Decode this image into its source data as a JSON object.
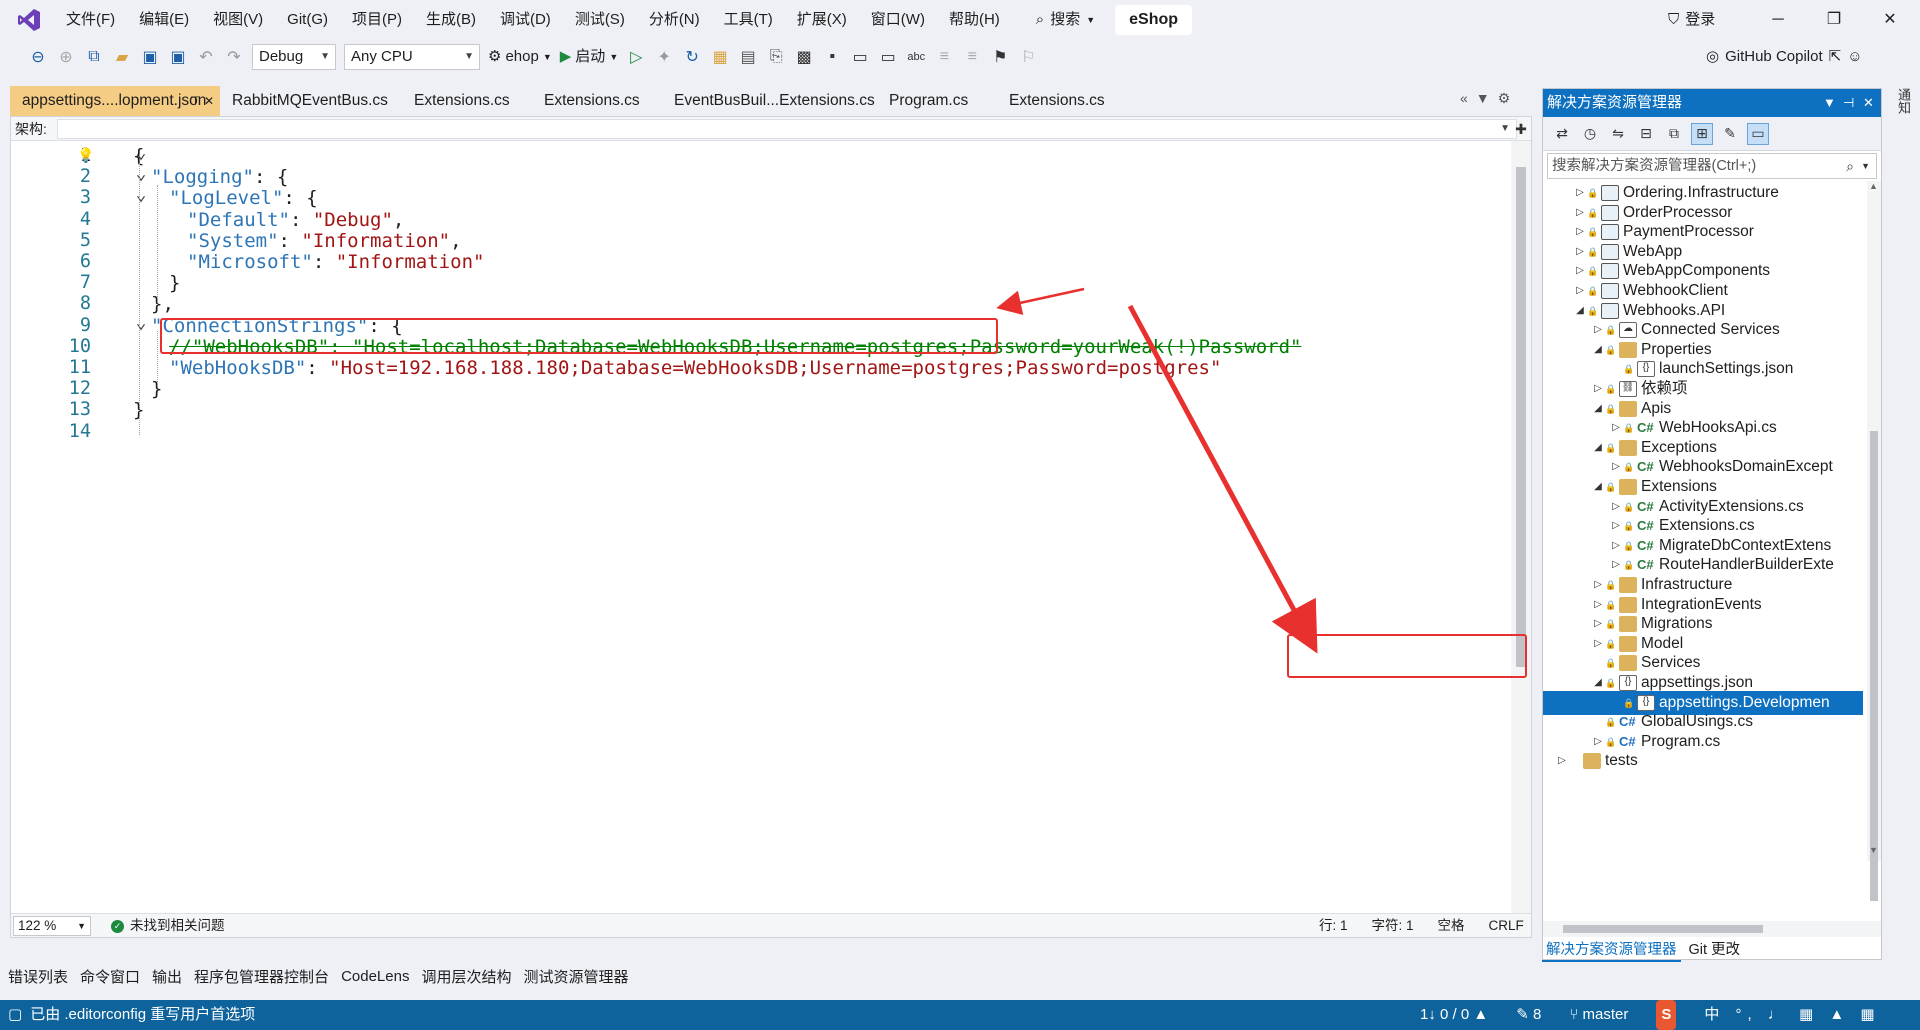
{
  "menu": [
    "文件(F)",
    "编辑(E)",
    "视图(V)",
    "Git(G)",
    "项目(P)",
    "生成(B)",
    "调试(D)",
    "测试(S)",
    "分析(N)",
    "工具(T)",
    "扩展(X)",
    "窗口(W)",
    "帮助(H)"
  ],
  "titlebar": {
    "search_label": "搜索",
    "solution_name": "eShop",
    "login_label": "登录"
  },
  "toolbar": {
    "config": "Debug",
    "platform": "Any CPU",
    "startup_project": "ehop",
    "start_label": "启动",
    "copilot_label": "GitHub Copilot"
  },
  "tabs": [
    "appsettings....lopment.json",
    "RabbitMQEventBus.cs",
    "Extensions.cs",
    "Extensions.cs",
    "EventBusBuil...Extensions.cs",
    "Program.cs",
    "Extensions.cs"
  ],
  "editor": {
    "nav_label": "架构:",
    "lines": [
      {
        "n": "1",
        "t": "{"
      },
      {
        "n": "2",
        "k": "\"Logging\"",
        "t": ": {"
      },
      {
        "n": "3",
        "k": "\"LogLevel\"",
        "t": ": {"
      },
      {
        "n": "4",
        "k": "\"Default\"",
        "t": ": ",
        "v": "\"Debug\"",
        "e": ","
      },
      {
        "n": "5",
        "k": "\"System\"",
        "t": ": ",
        "v": "\"Information\"",
        "e": ","
      },
      {
        "n": "6",
        "k": "\"Microsoft\"",
        "t": ": ",
        "v": "\"Information\"",
        "e": ""
      },
      {
        "n": "7",
        "t": "}"
      },
      {
        "n": "8",
        "t": "},"
      },
      {
        "n": "9",
        "k": "\"ConnectionStrings\"",
        "t": ": {"
      },
      {
        "n": "10",
        "c": "//\"WebHooksDB\": \"Host=localhost;Database=WebHooksDB;Username=postgres;Password=yourWeak(!)Password\""
      },
      {
        "n": "11",
        "k": "\"WebHooksDB\"",
        "t": ": ",
        "v": "\"Host=192.168.188.180;Database=WebHooksDB;Username=postgres;Password=postgres\"",
        "e": ""
      },
      {
        "n": "12",
        "t": "}"
      },
      {
        "n": "13",
        "t": "}"
      },
      {
        "n": "14",
        "t": ""
      }
    ],
    "zoom": "122 %",
    "issues": "未找到相关问题",
    "line_info": "行: 1",
    "char_info": "字符: 1",
    "whitespace": "空格",
    "eol": "CRLF"
  },
  "bottom_tabs": [
    "错误列表",
    "命令窗口",
    "输出",
    "程序包管理器控制台",
    "CodeLens",
    "调用层次结构",
    "测试资源管理器"
  ],
  "statusbar": {
    "message": "已由 .editorconfig 重写用户首选项",
    "sync": "1↓ 0 / 0 ▲",
    "edits": "8",
    "branch": "master"
  },
  "solution_explorer": {
    "title": "解决方案资源管理器",
    "search_placeholder": "搜索解决方案资源管理器(Ctrl+;)",
    "items": [
      {
        "label": "Ordering.Infrastructure",
        "type": "proj",
        "lvl": 1,
        "exp": "▷"
      },
      {
        "label": "OrderProcessor",
        "type": "proj",
        "lvl": 1,
        "exp": "▷"
      },
      {
        "label": "PaymentProcessor",
        "type": "proj",
        "lvl": 1,
        "exp": "▷"
      },
      {
        "label": "WebApp",
        "type": "proj",
        "lvl": 1,
        "exp": "▷"
      },
      {
        "label": "WebAppComponents",
        "type": "proj",
        "lvl": 1,
        "exp": "▷"
      },
      {
        "label": "WebhookClient",
        "type": "proj",
        "lvl": 1,
        "exp": "▷"
      },
      {
        "label": "Webhooks.API",
        "type": "proj",
        "lvl": 1,
        "exp": "◢"
      },
      {
        "label": "Connected Services",
        "type": "svc",
        "lvl": 2,
        "exp": "▷"
      },
      {
        "label": "Properties",
        "type": "folder",
        "lvl": 2,
        "exp": "◢"
      },
      {
        "label": "launchSettings.json",
        "type": "json",
        "lvl": 3,
        "exp": ""
      },
      {
        "label": "依赖项",
        "type": "dep",
        "lvl": 2,
        "exp": "▷"
      },
      {
        "label": "Apis",
        "type": "folder",
        "lvl": 2,
        "exp": "◢"
      },
      {
        "label": "WebHooksApi.cs",
        "type": "cs",
        "lvl": 3,
        "exp": "▷"
      },
      {
        "label": "Exceptions",
        "type": "folder",
        "lvl": 2,
        "exp": "◢"
      },
      {
        "label": "WebhooksDomainExcept",
        "type": "cs",
        "lvl": 3,
        "exp": "▷"
      },
      {
        "label": "Extensions",
        "type": "folder",
        "lvl": 2,
        "exp": "◢"
      },
      {
        "label": "ActivityExtensions.cs",
        "type": "cs",
        "lvl": 3,
        "exp": "▷"
      },
      {
        "label": "Extensions.cs",
        "type": "cs",
        "lvl": 3,
        "exp": "▷"
      },
      {
        "label": "MigrateDbContextExtens",
        "type": "cs",
        "lvl": 3,
        "exp": "▷"
      },
      {
        "label": "RouteHandlerBuilderExte",
        "type": "cs",
        "lvl": 3,
        "exp": "▷"
      },
      {
        "label": "Infrastructure",
        "type": "folder",
        "lvl": 2,
        "exp": "▷"
      },
      {
        "label": "IntegrationEvents",
        "type": "folder",
        "lvl": 2,
        "exp": "▷"
      },
      {
        "label": "Migrations",
        "type": "folder",
        "lvl": 2,
        "exp": "▷"
      },
      {
        "label": "Model",
        "type": "folder",
        "lvl": 2,
        "exp": "▷"
      },
      {
        "label": "Services",
        "type": "folder",
        "lvl": 2,
        "exp": ""
      },
      {
        "label": "appsettings.json",
        "type": "json",
        "lvl": 2,
        "exp": "◢"
      },
      {
        "label": "appsettings.Developmen",
        "type": "json",
        "lvl": 3,
        "exp": "",
        "selected": true
      },
      {
        "label": "GlobalUsings.cs",
        "type": "cs2",
        "lvl": 2,
        "exp": ""
      },
      {
        "label": "Program.cs",
        "type": "cs2",
        "lvl": 2,
        "exp": "▷"
      },
      {
        "label": "tests",
        "type": "folder",
        "lvl": 0,
        "exp": "▷"
      }
    ],
    "bottom_tabs": [
      "解决方案资源管理器",
      "Git 更改"
    ]
  },
  "right_strip": "通知",
  "colors": {
    "accent": "#0e70c0",
    "tab_active": "#f5cc84",
    "annotation": "#e8312f",
    "statusbar": "#0e639c"
  }
}
